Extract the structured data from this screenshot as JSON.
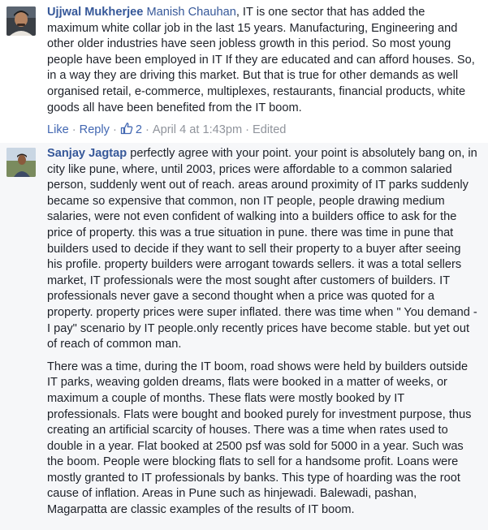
{
  "comments": [
    {
      "author": "Ujjwal Mukherjee",
      "mention": "Manish Chauhan",
      "text": ", IT is one sector that has added the maximum white collar job in the last 15 years. Manufacturing, Engineering and other older industries have seen jobless growth in this period. So most young people have been employed in IT If they are educated and can afford houses. So, in a way they are driving this market. But that is true for other demands as well organised retail, e-commerce, multiplexes, restaurants, financial products, white goods all have been benefited from the IT boom.",
      "actions": {
        "like": "Like",
        "reply": "Reply",
        "like_count": "2",
        "timestamp": "April 4 at 1:43pm",
        "edited": "Edited"
      }
    },
    {
      "author": "Sanjay Jagtap",
      "text": " perfectly agree with your point. your point is absolutely bang on, in city like pune, where, until 2003, prices were affordable to a common salaried person, suddenly went out of reach. areas around proximity of IT parks suddenly became so expensive that common, non IT people, people drawing medium salaries, were not even confident of walking into a builders office to ask for the price of property. this was a true situation in pune. there was time in pune that builders used to decide if they want to sell their property to a buyer after seeing his profile. property builders were arrogant towards sellers. it was a total sellers market, IT professionals were the most sought after customers of builders. IT professionals never gave a second thought when a price was quoted for a property. property prices were super inflated. there was time when \" You demand - I pay\" scenario by IT people.only recently prices have become stable. but yet out of reach of common man.",
      "text2": "There was a time, during the IT boom, road shows were held by builders outside IT parks, weaving golden dreams, flats were booked in a matter of weeks, or maximum a couple of months. These flats were mostly booked by IT professionals. Flats were bought and booked purely for investment purpose, thus creating an artificial scarcity of houses. There was a time when rates used to double in a year. Flat booked at 2500 psf was sold for 5000 in a year. Such was the boom. People were blocking flats to sell for a handsome profit. Loans were mostly granted to IT professionals by banks. This type of hoarding was the root cause of inflation. Areas in Pune such as hinjewadi. Balewadi, pashan, Magarpatta are classic examples of the results of IT boom."
    }
  ],
  "icons": {
    "like_thumb": "thumbs-up-icon"
  },
  "colors": {
    "link": "#365899",
    "action_link": "#4267b2",
    "meta": "#90949c",
    "text": "#1d2129",
    "highlight_bg": "#f6f7f9"
  }
}
